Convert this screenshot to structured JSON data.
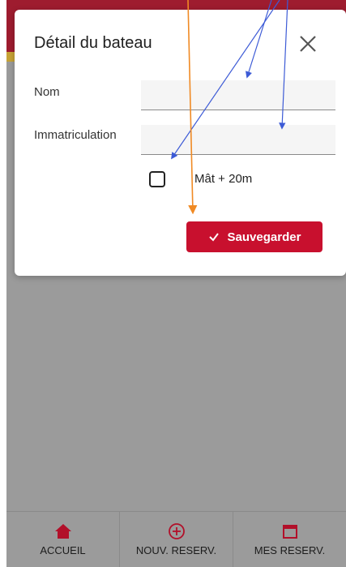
{
  "dialog": {
    "title": "Détail du bateau",
    "fields": {
      "nom": {
        "label": "Nom",
        "value": ""
      },
      "immatriculation": {
        "label": "Immatriculation",
        "value": ""
      }
    },
    "checkbox": {
      "label": "Mât + 20m",
      "checked": false
    },
    "save_button": {
      "label": "Sauvegarder",
      "icon": "check-icon"
    },
    "close_icon": "close-icon"
  },
  "bottom_nav": {
    "items": [
      {
        "label": "ACCUEIL",
        "icon": "home-icon"
      },
      {
        "label": "NOUV. RESERV.",
        "icon": "plus-circle-icon"
      },
      {
        "label": "MES RESERV.",
        "icon": "calendar-icon"
      }
    ]
  },
  "colors": {
    "brand": "#9e1c2f",
    "accent_gold": "#c7a336",
    "primary_button": "#c8102e",
    "overlay": "#9b9b9b",
    "arrow_blue": "#3d5bd6",
    "arrow_orange": "#f08a24"
  }
}
